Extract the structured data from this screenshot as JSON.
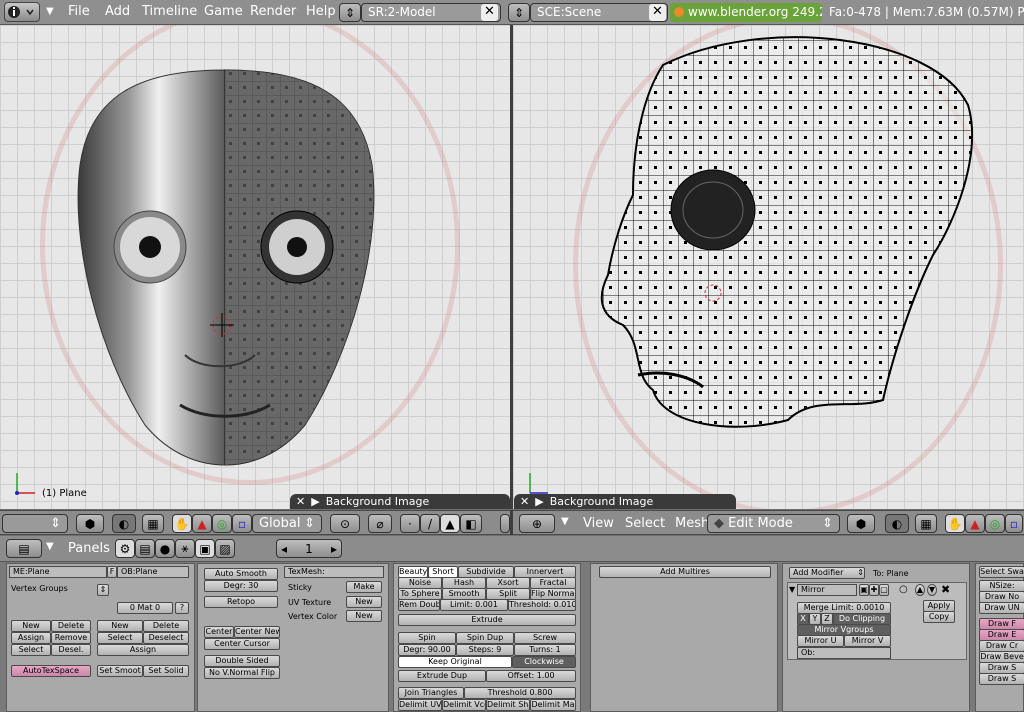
{
  "topbar": {
    "menus": [
      "File",
      "Add",
      "Timeline",
      "Game",
      "Render",
      "Help"
    ],
    "screen_field": "SR:2-Model",
    "scene_field": "SCE:Scene",
    "url": "www.blender.org 249.2",
    "stats": "Fa:0-478 | Mem:7.63M (0.57M) P"
  },
  "viewport_left": {
    "object_label": "(1) Plane",
    "bg_panel_label": "Background Image"
  },
  "viewport_right": {
    "bg_panel_label": "Background Image"
  },
  "header_left": {
    "orientation": "Global"
  },
  "header_right": {
    "menus": [
      "View",
      "Select",
      "Mesh"
    ],
    "mode": "Edit Mode"
  },
  "buttons_header": {
    "panels_label": "Panels",
    "frame": "1"
  },
  "link_panel": {
    "me_field": "ME:Plane",
    "f_label": "F",
    "ob_field": "OB:Plane",
    "vertex_groups": "Vertex Groups",
    "mat_field": "0 Mat 0",
    "question": "?",
    "new1": "New",
    "delete1": "Delete",
    "assign1": "Assign",
    "remove": "Remove",
    "select1": "Select",
    "desel": "Desel.",
    "new2": "New",
    "delete2": "Delete",
    "select2": "Select",
    "deselect2": "Deselect",
    "assign2": "Assign",
    "autotexspace": "AutoTexSpace",
    "set_smooth": "Set Smoot",
    "set_solid": "Set Solid"
  },
  "mesh_panel": {
    "auto_smooth": "Auto Smooth",
    "degr": "Degr: 30",
    "retopo": "Retopo",
    "center": "Center",
    "center_new": "Center New",
    "center_cursor": "Center Cursor",
    "double_sided": "Double Sided",
    "no_v_normal_flip": "No V.Normal Flip",
    "texmesh": "TexMesh:",
    "sticky": "Sticky",
    "make": "Make",
    "uv_texture": "UV Texture",
    "new_uv": "New",
    "vertex_color": "Vertex Color",
    "new_vc": "New"
  },
  "mesh_tools": {
    "beauty": "Beauty",
    "short": "Short",
    "subdivide": "Subdivide",
    "innervert": "Innervert",
    "noise": "Noise",
    "hash": "Hash",
    "xsort": "Xsort",
    "fractal": "Fractal",
    "to_sphere": "To Sphere",
    "smooth": "Smooth",
    "split": "Split",
    "flip_normal": "Flip Normal",
    "rem_doubl": "Rem Doubl",
    "limit": "Limit: 0.001",
    "threshold": "Threshold: 0.010",
    "extrude": "Extrude",
    "spin": "Spin",
    "spin_dup": "Spin Dup",
    "screw": "Screw",
    "degr_spin": "Degr: 90.00",
    "steps": "Steps: 9",
    "turns": "Turns: 1",
    "keep_original": "Keep Original",
    "clockwise": "Clockwise",
    "extrude_dup": "Extrude Dup",
    "offset": "Offset: 1.00",
    "join_triangles": "Join Triangles",
    "threshold2": "Threshold 0.800",
    "delimit_uv": "Delimit UV",
    "delimit_vco": "Delimit Vco",
    "delimit_sha": "Delimit Sha",
    "delimit_ma": "Delimit Ma"
  },
  "multires_panel": {
    "add_multires": "Add Multires"
  },
  "modifiers_panel": {
    "add_modifier": "Add Modifier",
    "to_label": "To: Plane",
    "mirror_name": "Mirror",
    "merge_limit": "Merge Limit: 0.0010",
    "x": "X",
    "y": "Y",
    "z": "Z",
    "do_clipping": "Do Clipping",
    "mirror_vgroups": "Mirror Vgroups",
    "mirror_u": "Mirror U",
    "mirror_v": "Mirror V",
    "ob": "Ob:",
    "apply": "Apply",
    "copy": "Copy"
  },
  "edit_panel": {
    "select_swap": "Select Swa",
    "nsize": "NSize:",
    "draw_no": "Draw No",
    "draw_un": "Draw UN",
    "draw_faces": "Draw F",
    "draw_edges": "Draw E",
    "draw_creases": "Draw Cr",
    "draw_bevel": "Draw Beve",
    "draw_seams": "Draw S",
    "draw_sharp": "Draw S"
  }
}
